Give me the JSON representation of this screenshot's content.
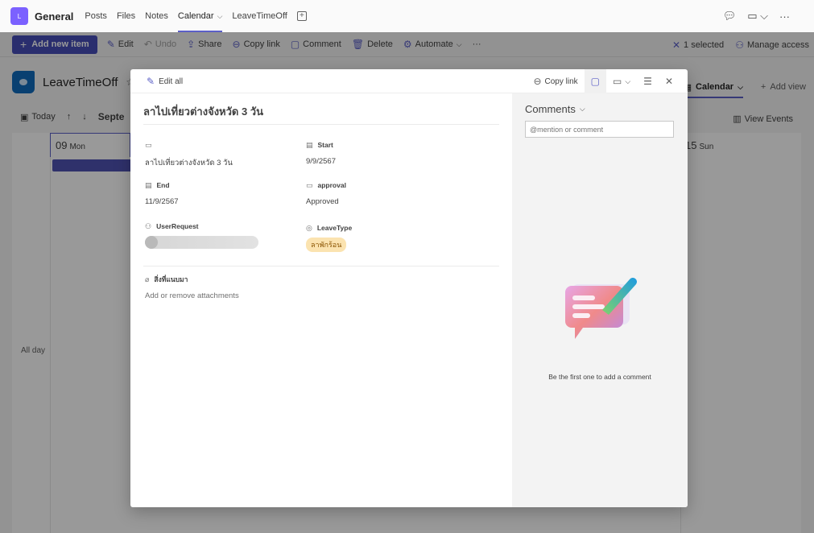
{
  "header": {
    "team_avatar_letter": "L",
    "team_name": "General",
    "tabs": [
      {
        "label": "Posts",
        "active": false
      },
      {
        "label": "Files",
        "active": false
      },
      {
        "label": "Notes",
        "active": false
      },
      {
        "label": "Calendar",
        "active": true,
        "has_dropdown": true
      },
      {
        "label": "LeaveTimeOff",
        "active": false
      }
    ],
    "add_tab_icon": "plus-square-icon",
    "right_icons": [
      "chat-icon",
      "video-call-icon",
      "more-options-icon"
    ]
  },
  "command_bar": {
    "add_new_item": "Add new item",
    "items": [
      {
        "label": "Edit",
        "icon": "pencil-icon",
        "disabled": false
      },
      {
        "label": "Undo",
        "icon": "undo-icon",
        "disabled": true
      },
      {
        "label": "Share",
        "icon": "share-icon",
        "disabled": false
      },
      {
        "label": "Copy link",
        "icon": "link-icon",
        "disabled": false
      },
      {
        "label": "Comment",
        "icon": "comment-icon",
        "disabled": false
      },
      {
        "label": "Delete",
        "icon": "trash-icon",
        "disabled": false
      },
      {
        "label": "Automate",
        "icon": "automate-icon",
        "disabled": false
      }
    ],
    "selected_label": "1 selected",
    "manage_access": "Manage access"
  },
  "list": {
    "title": "LeaveTimeOff",
    "views": [
      {
        "label": "Calendar",
        "active": true
      },
      {
        "label": "Add view",
        "active": false
      }
    ],
    "calendar": {
      "today_label": "Today",
      "month_label": "Septe",
      "view_events": "View Events",
      "days": [
        {
          "num": "09",
          "name": "Mon"
        },
        {
          "num": "15",
          "name": "Sun"
        }
      ],
      "all_day_label": "All day"
    }
  },
  "dialog": {
    "edit_all": "Edit all",
    "copy_link": "Copy link",
    "item_title": "ลาไปเที่ยวต่างจังหวัด 3 วัน",
    "fields": {
      "title": {
        "label": "",
        "value": "ลาไปเที่ยวต่างจังหวัด 3 วัน"
      },
      "start": {
        "label": "Start",
        "value": "9/9/2567"
      },
      "end": {
        "label": "End",
        "value": "11/9/2567"
      },
      "approval": {
        "label": "approval",
        "value": "Approved"
      },
      "user_request": {
        "label": "UserRequest",
        "value": ""
      },
      "leave_type": {
        "label": "LeaveType",
        "value": "ลาพักร้อน"
      },
      "attachments": {
        "label": "สิ่งที่แนบมา",
        "hint": "Add or remove attachments"
      }
    },
    "comments": {
      "title": "Comments",
      "placeholder": "@mention or comment",
      "empty_text": "Be the first one to add a comment"
    }
  },
  "colors": {
    "accent": "#5b5fc7",
    "primary_button": "#464eb8",
    "team_avatar": "#7b61ff",
    "list_logo": "#0f6cbd",
    "leave_type_tag_bg": "#fbe3b0"
  }
}
